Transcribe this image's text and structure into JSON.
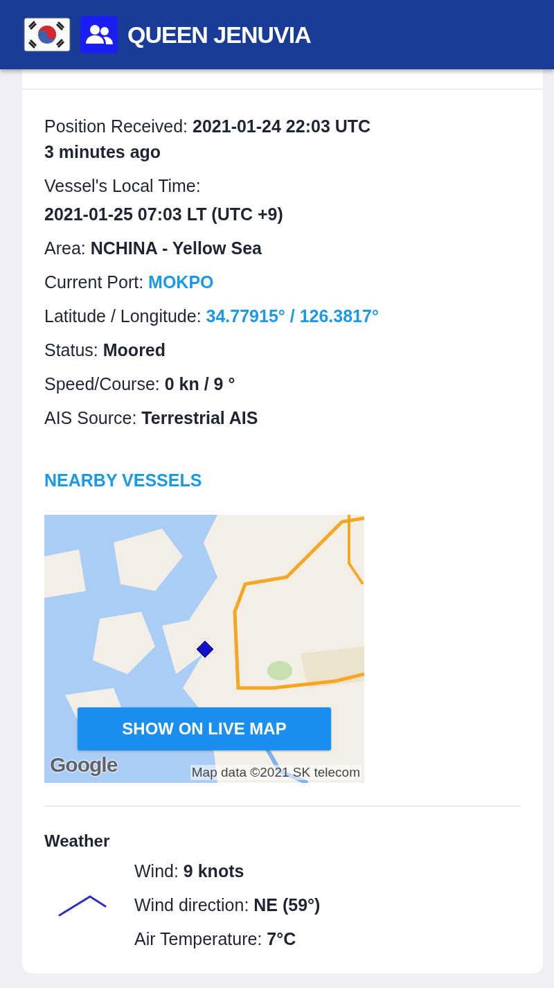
{
  "header": {
    "title": "QUEEN JENUVIA"
  },
  "details": [
    {
      "label": "Position Received:",
      "value": "2021-01-24 22:03 UTC",
      "kind": "bold",
      "note": "3 minutes ago"
    },
    {
      "label": "Vessel's Local Time:",
      "value": "2021-01-25 07:03 LT (UTC +9)",
      "kind": "stacked"
    },
    {
      "label": "Area:",
      "value": "NCHINA - Yellow Sea",
      "kind": "bold"
    },
    {
      "label": "Current Port:",
      "value": "MOKPO",
      "kind": "link"
    },
    {
      "label": "Latitude / Longitude:",
      "value": "34.77915° / 126.3817°",
      "kind": "link"
    },
    {
      "label": "Status:",
      "value": "Moored",
      "kind": "bold"
    },
    {
      "label": "Speed/Course:",
      "value": "0 kn / 9 °",
      "kind": "bold"
    },
    {
      "label": "AIS Source:",
      "value": "Terrestrial AIS",
      "kind": "bold"
    }
  ],
  "nearby": {
    "title": "NEARBY VESSELS",
    "map": {
      "kind": "picture",
      "button": "SHOW ON LIVE MAP",
      "logo": "Google",
      "attribution": "Map data ©2021 SK telecom"
    }
  },
  "weather": {
    "title": "Weather",
    "lines": [
      {
        "label": "Wind:",
        "value": "9 knots"
      },
      {
        "label": "Wind direction:",
        "value": "NE (59°)"
      },
      {
        "label": "Air Temperature:",
        "value": "7°C"
      }
    ]
  }
}
